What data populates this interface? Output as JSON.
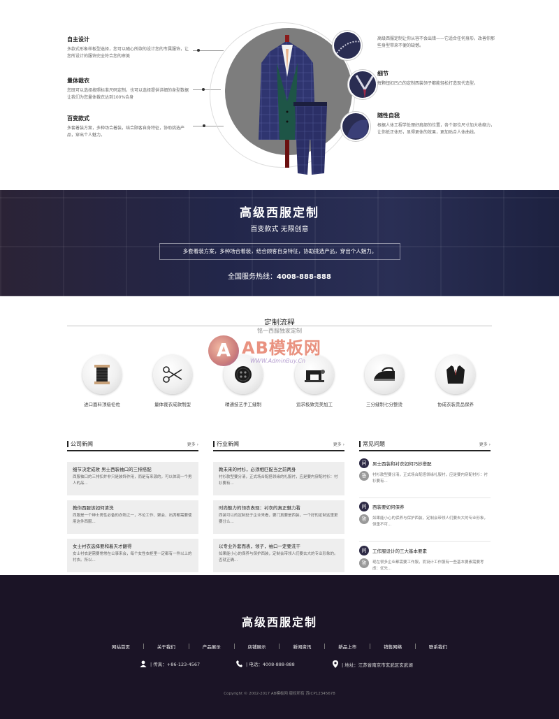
{
  "features": {
    "left": [
      {
        "title": "自主设计",
        "desc": "多款式形象样板型选择，您可以随心所欲的设计您的专属服饰，让您所设计的服饰完全符合您的审美"
      },
      {
        "title": "量体裁衣",
        "desc": "您既可以选择按照标准尺码定制，也可以选择提供详细的身型数据让我们为您量体裁衣达到100%合身"
      },
      {
        "title": "百变款式",
        "desc": "多套着装方案，多种场合着装，结合顾客自身特征，协助挑选产品，穿出个人魅力。"
      }
    ],
    "right": [
      {
        "title": "",
        "desc": "高级西服定制让你从容不会出错——它适合任何身形，改善你那些身型带来不便的缺憾。"
      },
      {
        "title": "细节",
        "desc": "每颗钮扣凹凸的定制西装领子都能轻松打造现代造型。"
      },
      {
        "title": "随性自我",
        "desc": "根据人体工程学处理好肩部的位置，各个部位尺寸加大收缩力，让你抵正体形，显得更体的效果，更加贴合人体曲线。"
      }
    ]
  },
  "banner": {
    "title": "高级西服定制",
    "subtitle": "百变款式 无限创意",
    "box_text": "多套着装方案，多种场合着装，结合顾客自身特征，协助挑选产品，穿出个人魅力。",
    "hotline_label": "全国服务热线：",
    "hotline_number": "4008-888-888"
  },
  "process": {
    "title": "定制流程",
    "subtitle": "铭一西服独家定制",
    "steps": [
      {
        "label": "进口面料顶级伦佐",
        "icon": "thread-spool-icon"
      },
      {
        "label": "量体裁衣成款制型",
        "icon": "scissors-icon"
      },
      {
        "label": "精通技艺手工缝制",
        "icon": "button-icon"
      },
      {
        "label": "追求极致完美加工",
        "icon": "sewing-machine-icon"
      },
      {
        "label": "三分缝制七分整烫",
        "icon": "iron-icon"
      },
      {
        "label": "协成衣装贵品保养",
        "icon": "jacket-icon"
      }
    ]
  },
  "watermark": {
    "logo_letter": "A",
    "brand": "AB模板网",
    "url": "WWW.AdminBuy.Cn"
  },
  "company_news": {
    "title": "公司新闻",
    "more": "更多 ›",
    "items": [
      {
        "title": "细节决定成败 男士西装袖口的三排搭配",
        "desc": "西服袖口的三排扣并非只是装饰作用，而是有来源的，可以体现一个男人的品..."
      },
      {
        "title": "教你西服该如何清洗",
        "desc": "西服是一个绅士男性必备的衣物之一，不论工作、聚会、出席都需要使用这件西服..."
      },
      {
        "title": "女士衬衣选择要和着天才翻得",
        "desc": "女士衬衣是需要常常在公事来会，每个女性衣柜里一定都有一件以上的衬衣。所以..."
      }
    ]
  },
  "industry_news": {
    "title": "行业新闻",
    "more": "更多 ›",
    "items": [
      {
        "title": "教未来的衬衫，必须相匹配当之前两身",
        "desc": "衬衫款型要分清，正式场合配搭领缘的礼服衬，应是要内穿配衬衫：衬衫要有..."
      },
      {
        "title": "时尚魅力的领衣表现：衬衣的真正魅力看",
        "desc": "西装可以的定制处于企业来看，要门真要是西装，一个好的定制这里更要分么..."
      },
      {
        "title": "以专业外套而表，领子，袖口一定要洗干",
        "desc": "如果能小心的保养与保护西装，定制会带领人们要去大的专业形象的。否就正确..."
      }
    ]
  },
  "faq": {
    "title": "常见问题",
    "more": "更多 ›",
    "items": [
      {
        "q": "男士西装和衬衣如何巧妙搭配",
        "a": "衬衫款型要分清，正式场合配搭领缘礼服衬，应是要内穿配衬衫：衬衫要有..."
      },
      {
        "q": "西装要如何保养",
        "a": "如果能小心的保养与保护西装，定制会带领人们要去大的专业形象，但重不可..."
      },
      {
        "q": "工作服设计的三大基本要素",
        "a": "现在很多企业都需要工作服，而设计工作服有一些基本要素需要考虑：优先..."
      }
    ]
  },
  "footer": {
    "title": "高级西服定制",
    "nav": [
      "网站首页",
      "关于我们",
      "产品展示",
      "店铺展示",
      "新闻资讯",
      "新品上市",
      "销售网络",
      "联系我们"
    ],
    "fax": "| 传真：+86-123-4567",
    "phone": "| 电话：4008-888-888",
    "address": "| 地址：江苏省南京市玄武区玄武湖",
    "copyright": "Copyright © 2002-2017 AB模板网 版权所有   苏ICP12345678"
  },
  "colors": {
    "banner_bg": "#22264a",
    "footer_bg": "#1b1426",
    "accent_dark": "#2d2a45"
  }
}
